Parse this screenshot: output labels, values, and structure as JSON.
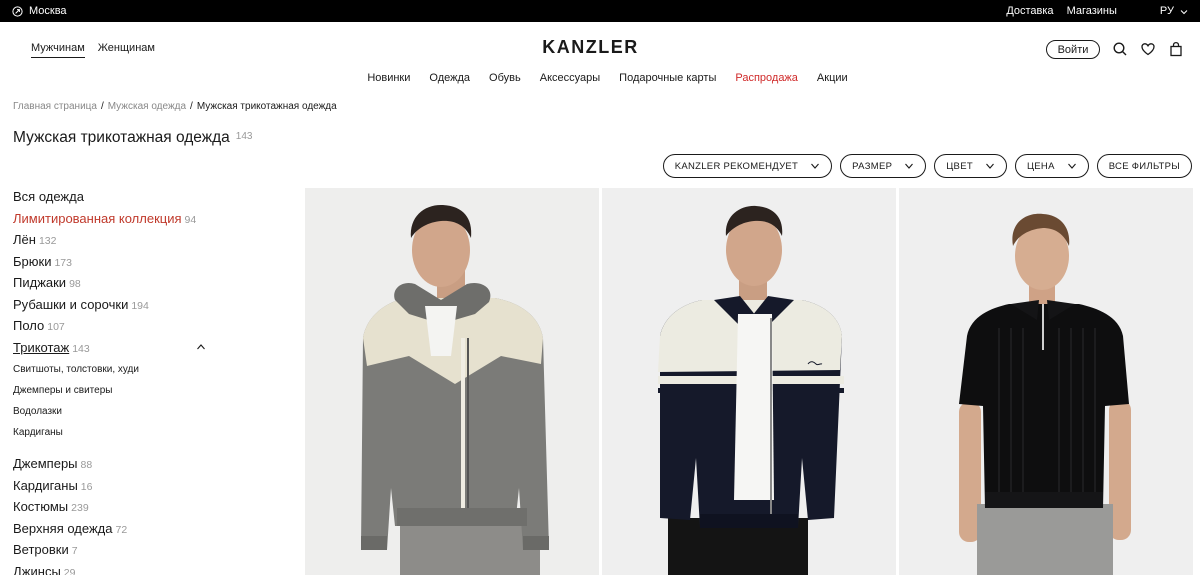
{
  "topbar": {
    "city": "Москва",
    "links": [
      "Доставка",
      "Магазины"
    ],
    "lang": "РУ"
  },
  "header": {
    "gender_tabs": [
      "Мужчинам",
      "Женщинам"
    ],
    "logo": "KANZLER",
    "login": "Войти",
    "icons": [
      "search-icon",
      "heart-icon",
      "bag-icon"
    ]
  },
  "nav": [
    "Новинки",
    "Одежда",
    "Обувь",
    "Аксессуары",
    "Подарочные карты",
    "Распродажа",
    "Акции"
  ],
  "breadcrumb": [
    "Главная страница",
    "Мужская одежда",
    "Мужская трикотажная одежда"
  ],
  "page": {
    "title": "Мужская трикотажная одежда",
    "count": "143"
  },
  "filters": [
    "KANZLER РЕКОМЕНДУЕТ",
    "РАЗМЕР",
    "ЦВЕТ",
    "ЦЕНА",
    "ВСЕ ФИЛЬТРЫ"
  ],
  "sidebar": {
    "items_top": [
      {
        "label": "Вся одежда",
        "count": ""
      },
      {
        "label": "Лимитированная коллекция",
        "count": "94"
      },
      {
        "label": "Лён",
        "count": "132"
      },
      {
        "label": "Брюки",
        "count": "173"
      },
      {
        "label": "Пиджаки",
        "count": "98"
      },
      {
        "label": "Рубашки и сорочки",
        "count": "194"
      },
      {
        "label": "Поло",
        "count": "107"
      },
      {
        "label": "Трикотаж",
        "count": "143"
      }
    ],
    "sub_items": [
      "Свитшоты, толстовки, худи",
      "Джемперы и свитеры",
      "Водолазки",
      "Кардиганы"
    ],
    "items_bottom": [
      {
        "label": "Джемперы",
        "count": "88"
      },
      {
        "label": "Кардиганы",
        "count": "16"
      },
      {
        "label": "Костюмы",
        "count": "239"
      },
      {
        "label": "Верхняя одежда",
        "count": "72"
      },
      {
        "label": "Ветровки",
        "count": "7"
      },
      {
        "label": "Джинсы",
        "count": "29"
      }
    ]
  },
  "colors": {
    "accent_red": "#c0392b",
    "sale_red": "#d02a2a"
  }
}
